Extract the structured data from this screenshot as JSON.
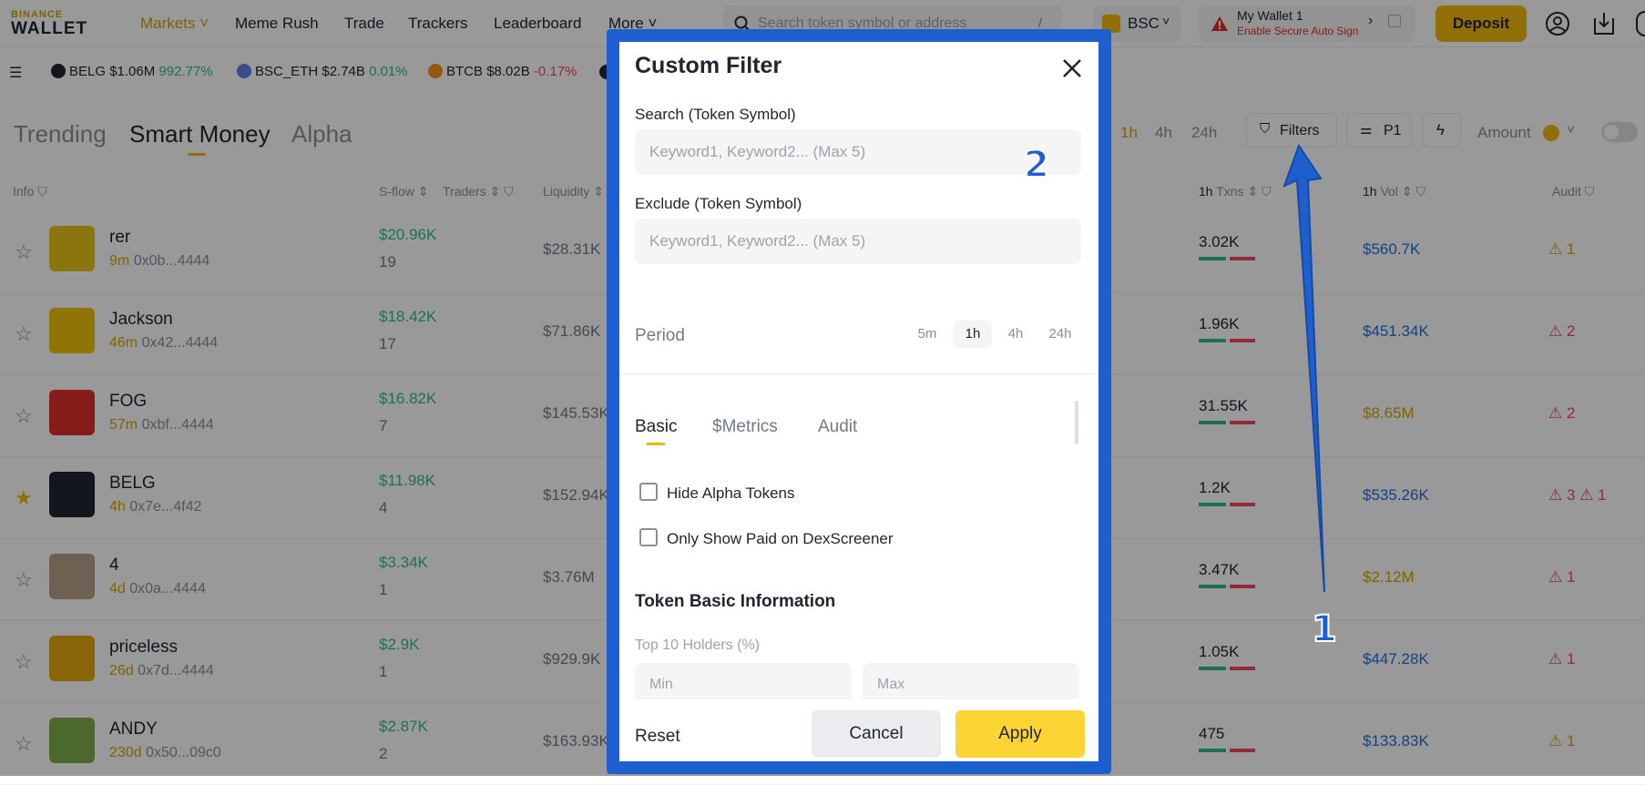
{
  "nav": {
    "logo_top": "BINANCE",
    "logo_bottom": "WALLET",
    "items": [
      "Markets",
      "Meme Rush",
      "Trade",
      "Trackers",
      "Leaderboard",
      "More"
    ],
    "search_placeholder": "Search token symbol or address",
    "search_shortcut": "/",
    "chain": "BSC",
    "wallet_name": "My Wallet 1",
    "wallet_warning": "Enable Secure Auto Sign",
    "deposit": "Deposit"
  },
  "ticker": [
    {
      "sym": "BELG",
      "cap": "$1.06M",
      "chg": "992.77%",
      "dir": "up",
      "color": "#202630"
    },
    {
      "sym": "BSC_ETH",
      "cap": "$2.74B",
      "chg": "0.01%",
      "dir": "up",
      "color": "#627eea"
    },
    {
      "sym": "BTCB",
      "cap": "$8.02B",
      "chg": "-0.17%",
      "dir": "down",
      "color": "#f7931a"
    }
  ],
  "tabs": [
    "Trending",
    "Smart Money",
    "Alpha"
  ],
  "toolbar": {
    "periods": [
      "1h",
      "4h",
      "24h"
    ],
    "filters": "Filters",
    "preset": "P1",
    "amount": "Amount"
  },
  "headers": {
    "info": "Info",
    "sflow": "S-flow",
    "traders": "Traders",
    "liquidity": "Liquidity",
    "txns_prefix": "1h",
    "txns": "Txns",
    "vol_prefix": "1h",
    "vol": "Vol",
    "audit": "Audit"
  },
  "rows": [
    {
      "name": "rer",
      "age": "9m",
      "addr": "0x0b...4444",
      "sflow": "$20.96K",
      "traders": "19",
      "liq": "$28.31K",
      "txns": "3.02K",
      "vol": "$560.7K",
      "vol_color": "blue",
      "audit": "⚠ 1",
      "audit_color": "gold",
      "avatar_color": "#e8c31a",
      "starred": false
    },
    {
      "name": "Jackson",
      "age": "46m",
      "addr": "0x42...4444",
      "sflow": "$18.42K",
      "traders": "17",
      "liq": "$71.86K",
      "txns": "1.96K",
      "vol": "$451.34K",
      "vol_color": "blue",
      "audit": "⚠ 2",
      "audit_color": "red",
      "avatar_color": "#f2c10a",
      "starred": false
    },
    {
      "name": "FOG",
      "age": "57m",
      "addr": "0xbf...4444",
      "sflow": "$16.82K",
      "traders": "7",
      "liq": "$145.53K",
      "txns": "31.55K",
      "vol": "$8.65M",
      "vol_color": "gold",
      "audit": "⚠ 2",
      "audit_color": "red",
      "avatar_color": "#e0302c",
      "starred": false
    },
    {
      "name": "BELG",
      "age": "4h",
      "addr": "0x7e...4f42",
      "sflow": "$11.98K",
      "traders": "4",
      "liq": "$152.94K",
      "txns": "1.2K",
      "vol": "$535.26K",
      "vol_color": "blue",
      "audit": "⚠ 3 ⚠ 1",
      "audit_color": "red",
      "avatar_color": "#202630",
      "starred": true
    },
    {
      "name": "4",
      "age": "4d",
      "addr": "0x0a...4444",
      "sflow": "$3.34K",
      "traders": "1",
      "liq": "$3.76M",
      "txns": "3.47K",
      "vol": "$2.12M",
      "vol_color": "gold",
      "audit": "⚠ 1",
      "audit_color": "red",
      "avatar_color": "#b8a08a",
      "starred": false
    },
    {
      "name": "priceless",
      "age": "26d",
      "addr": "0x7d...4444",
      "sflow": "$2.9K",
      "traders": "1",
      "liq": "$929.9K",
      "txns": "1.05K",
      "vol": "$447.28K",
      "vol_color": "blue",
      "audit": "⚠ 1",
      "audit_color": "red",
      "avatar_color": "#e5a810",
      "starred": false
    },
    {
      "name": "ANDY",
      "age": "230d",
      "addr": "0x50...09c0",
      "sflow": "$2.87K",
      "traders": "2",
      "liq": "$163.93K",
      "txns": "475",
      "vol": "$133.83K",
      "vol_color": "blue",
      "audit": "⚠ 1",
      "audit_color": "gold",
      "avatar_color": "#7fae4a",
      "starred": false
    }
  ],
  "modal": {
    "title": "Custom Filter",
    "search_label": "Search (Token Symbol)",
    "search_placeholder": "Keyword1, Keyword2... (Max 5)",
    "exclude_label": "Exclude (Token Symbol)",
    "exclude_placeholder": "Keyword1, Keyword2... (Max 5)",
    "period_label": "Period",
    "periods": [
      "5m",
      "1h",
      "4h",
      "24h"
    ],
    "active_period": "1h",
    "tabs": [
      "Basic",
      "$Metrics",
      "Audit"
    ],
    "hide_alpha": "Hide Alpha Tokens",
    "only_paid": "Only Show Paid on DexScreener",
    "section": "Token Basic Information",
    "top10_label": "Top 10 Holders (%)",
    "min": "Min",
    "max": "Max",
    "reset": "Reset",
    "cancel": "Cancel",
    "apply": "Apply"
  },
  "annotations": {
    "one": "1",
    "two": "2"
  }
}
